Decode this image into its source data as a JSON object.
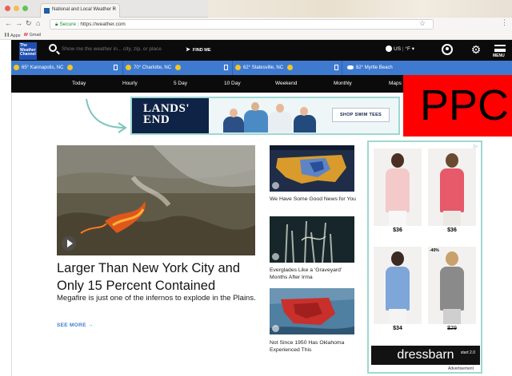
{
  "browser": {
    "tab_title": "National and Local Weather R",
    "tab_close": "×",
    "secure_label": "Secure",
    "url": "https://weather.com",
    "bookmarks": [
      {
        "label": "Apps"
      },
      {
        "label": "Gmail"
      }
    ]
  },
  "header": {
    "logo_text": "The Weather Channel",
    "search_placeholder": "Show me the weather in... city, zip, or place",
    "find_me": "FIND ME",
    "locale": "US",
    "units": "°F",
    "menu_label": "MENU"
  },
  "saved_locations": [
    {
      "temp": "65°",
      "name": "Kannapolis, NC",
      "condition": "sunny"
    },
    {
      "temp": "70°",
      "name": "Charlotte, NC",
      "condition": "sunny"
    },
    {
      "temp": "62°",
      "name": "Statesville, NC",
      "condition": "sunny"
    },
    {
      "temp": "82°",
      "name": "Myrtle Beach",
      "condition": "cloudy"
    }
  ],
  "forecast_tabs": [
    "Today",
    "Hourly",
    "5 Day",
    "10 Day",
    "Weekend",
    "Monthly",
    "Maps"
  ],
  "overlay": {
    "text": "PPC",
    "color": "#ff0000"
  },
  "banner_ad": {
    "brand_line1": "LANDS'",
    "brand_line2": "END",
    "cta": "SHOP SWIM TEES"
  },
  "featured": {
    "headline": "Larger Than New York City and Only 15 Percent Contained",
    "summary": "Megafire is just one of the infernos to explode in the Plains.",
    "see_more": "SEE MORE →"
  },
  "side_stories": [
    {
      "title": "We Have Some Good News for You"
    },
    {
      "title": "Everglades Like a 'Graveyard' Months After Irma"
    },
    {
      "title": "Not Since 1950 Has Oklahoma Experienced This"
    }
  ],
  "side_ad": {
    "prices": [
      "$36",
      "$36",
      "$34",
      "$29"
    ],
    "discount_badge": "-40%",
    "brand": "dressbarn",
    "brand_sub": "start 2.0",
    "label": "Advertisement",
    "ad_choices": "▷"
  },
  "colors": {
    "header_bg": "#0b0b0b",
    "locations_bg": "#3e7ad0",
    "accent": "#3f7bd2",
    "ad_border": "#9fd9d0"
  }
}
